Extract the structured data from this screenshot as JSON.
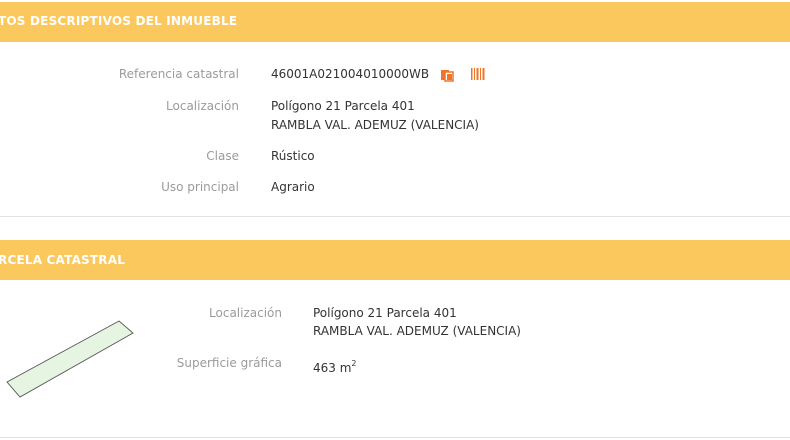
{
  "section1": {
    "title": "TOS DESCRIPTIVOS DEL INMUEBLE",
    "rows": {
      "ref_label": "Referencia catastral",
      "ref_value": "46001A021004010000WB",
      "loc_label": "Localización",
      "loc_line1": "Polígono 21 Parcela 401",
      "loc_line2": "RAMBLA VAL. ADEMUZ (VALENCIA)",
      "clase_label": "Clase",
      "clase_value": "Rústico",
      "uso_label": "Uso principal",
      "uso_value": "Agrario"
    },
    "icons": [
      "copy-icon",
      "barcode-icon"
    ]
  },
  "section2": {
    "title": "RCELA CATASTRAL",
    "rows": {
      "loc_label": "Localización",
      "loc_line1": "Polígono 21 Parcela 401",
      "loc_line2": "RAMBLA VAL. ADEMUZ (VALENCIA)",
      "sup_label": "Superficie gráfica",
      "sup_value": "463 m",
      "sup_unit_sup": "2"
    }
  },
  "colors": {
    "header": "#fbc85d",
    "icon_accent": "#f0742a",
    "parcel_fill": "#e6f5e1"
  }
}
